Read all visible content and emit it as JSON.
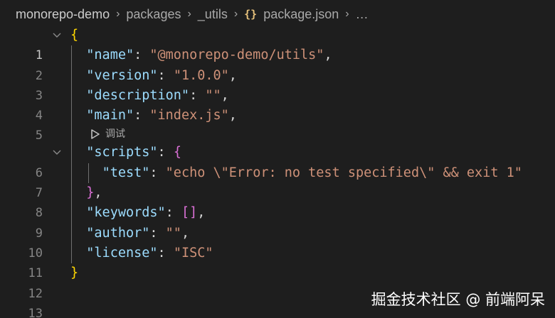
{
  "breadcrumb": {
    "items": [
      "monorepo-demo",
      "packages",
      "_utils",
      "package.json",
      "…"
    ],
    "file_icon_glyph": "{}"
  },
  "lines": [
    {
      "n": "1"
    },
    {
      "n": "2",
      "key": "\"name\"",
      "value": "\"@monorepo-demo/utils\""
    },
    {
      "n": "3",
      "key": "\"version\"",
      "value": "\"1.0.0\""
    },
    {
      "n": "4",
      "key": "\"description\"",
      "value": "\"\""
    },
    {
      "n": "5",
      "key": "\"main\"",
      "value": "\"index.js\""
    },
    {
      "n": "6",
      "key": "\"scripts\""
    },
    {
      "n": "7",
      "key": "\"test\"",
      "value": "\"echo \\\"Error: no test specified\\\" && exit 1\""
    },
    {
      "n": "8"
    },
    {
      "n": "9",
      "key": "\"keywords\""
    },
    {
      "n": "10",
      "key": "\"author\"",
      "value": "\"\""
    },
    {
      "n": "11",
      "key": "\"license\"",
      "value": "\"ISC\""
    },
    {
      "n": "12"
    },
    {
      "n": "13"
    }
  ],
  "code_lens": {
    "label": "调试"
  },
  "watermark": "掘金技术社区 @ 前端阿呆",
  "colors": {
    "background": "#1e1e1e",
    "key": "#9cdcfe",
    "string": "#ce9178",
    "bracket_level1": "#ffd700",
    "bracket_level2": "#da70d6"
  }
}
